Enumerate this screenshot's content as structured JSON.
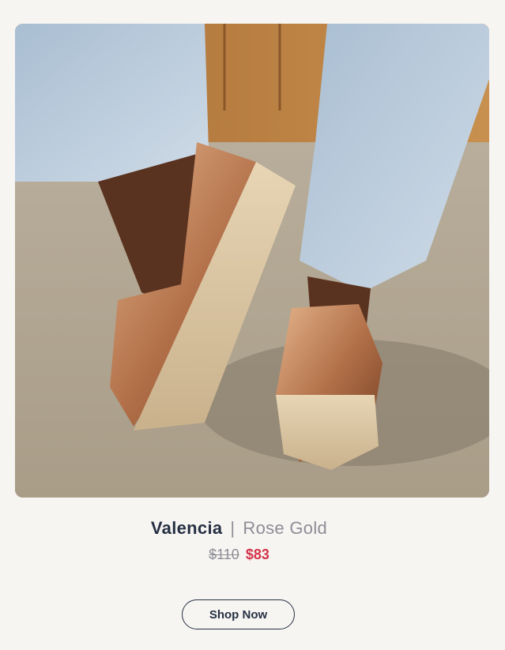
{
  "product": {
    "name": "Valencia",
    "separator": "|",
    "color": "Rose Gold",
    "original_price": "$110",
    "sale_price": "$83",
    "image_alt": "product-photo"
  },
  "cta": {
    "label": "Shop Now"
  },
  "colors": {
    "name": "#263043",
    "muted": "#8d8d96",
    "sale": "#d43348",
    "background": "#f7f5f2"
  }
}
